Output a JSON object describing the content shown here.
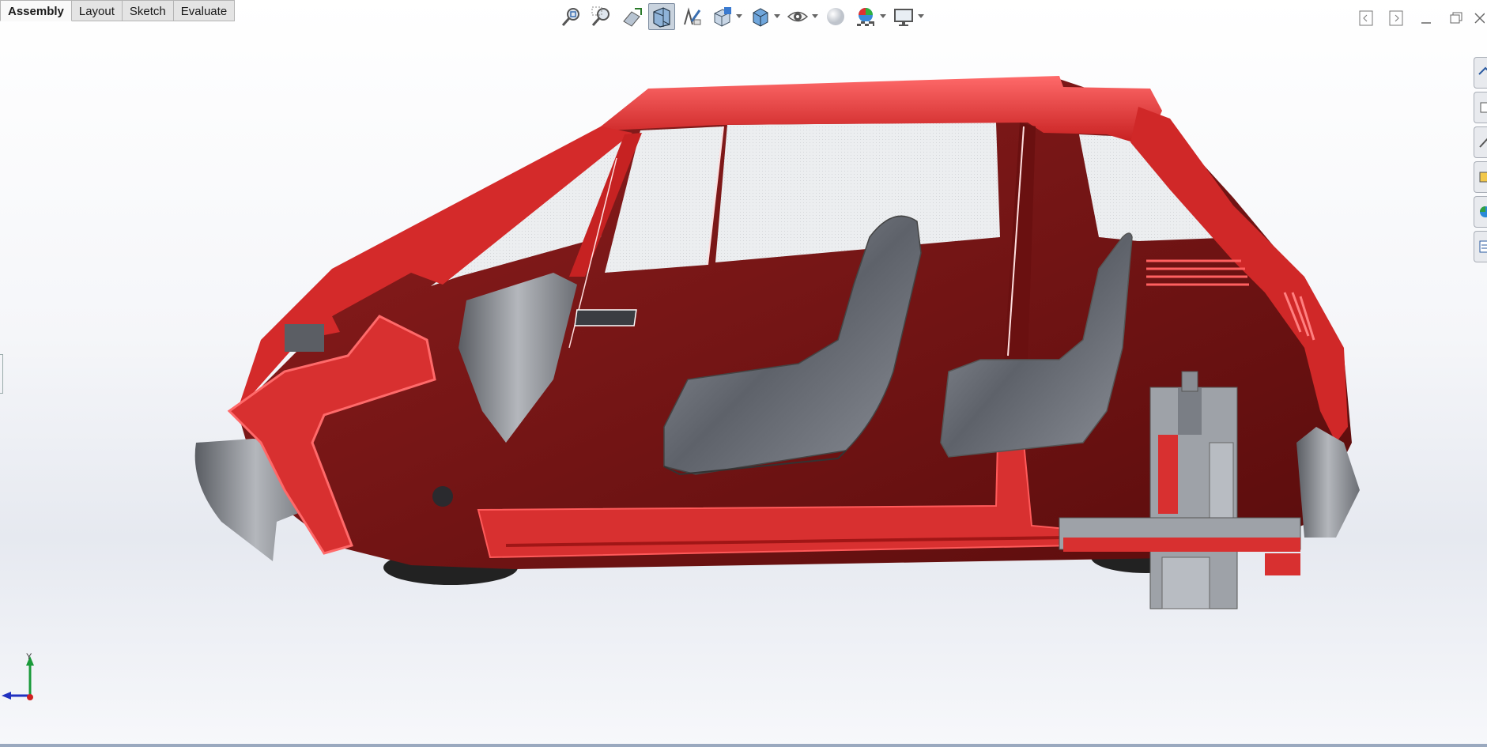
{
  "tabs": [
    {
      "label": "Assembly",
      "active": true
    },
    {
      "label": "Layout",
      "active": false
    },
    {
      "label": "Sketch",
      "active": false
    },
    {
      "label": "Evaluate",
      "active": false
    }
  ],
  "triad": {
    "y_label": "Y"
  },
  "colors": {
    "body_red": "#d42a2a",
    "body_dark": "#7a1414",
    "seat_gray": "#6b6e75",
    "glass": "#e8eaec",
    "toolbar_active": "#c9d3de",
    "triad_y": "#1a9a3a",
    "triad_x": "#d02020",
    "triad_z": "#2030c0"
  },
  "hud_icons": [
    "zoom-to-fit-icon",
    "zoom-to-area-icon",
    "previous-view-icon",
    "section-view-icon",
    "dynamic-annotation-icon",
    "view-orientation-icon",
    "display-style-icon",
    "hide-show-items-icon",
    "edit-appearance-icon",
    "apply-scene-icon",
    "view-settings-icon"
  ]
}
